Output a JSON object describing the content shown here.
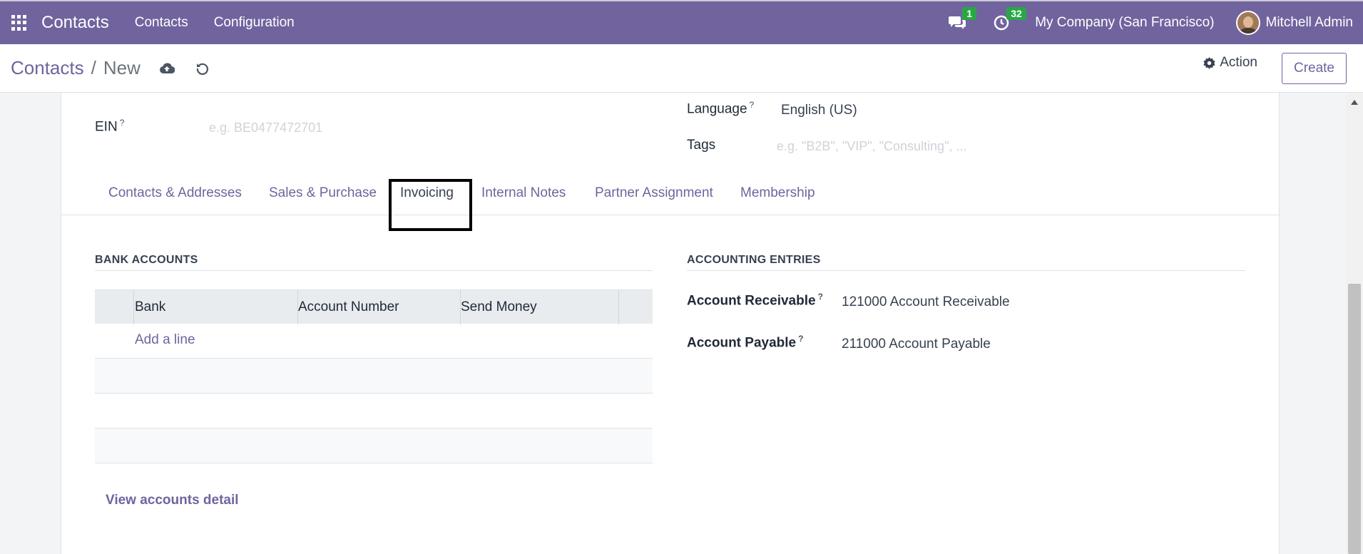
{
  "navbar": {
    "app_name": "Contacts",
    "menu": [
      "Contacts",
      "Configuration"
    ],
    "messages_badge": "1",
    "activities_badge": "32",
    "company": "My Company (San Francisco)",
    "user": "Mitchell Admin",
    "color": "#71639e"
  },
  "control_panel": {
    "breadcrumb_parent": "Contacts",
    "breadcrumb_separator": "/",
    "breadcrumb_current": "New",
    "action_label": "Action",
    "create_label": "Create"
  },
  "form": {
    "ein_label": "EIN",
    "ein_placeholder": "e.g. BE0477472701",
    "language_label": "Language",
    "language_value": "English (US)",
    "tags_label": "Tags",
    "tags_placeholder": "e.g. \"B2B\", \"VIP\", \"Consulting\", ...",
    "help_mark": "?"
  },
  "tabs": [
    {
      "label": "Contacts & Addresses",
      "active": false
    },
    {
      "label": "Sales & Purchase",
      "active": false
    },
    {
      "label": "Invoicing",
      "active": true
    },
    {
      "label": "Internal Notes",
      "active": false
    },
    {
      "label": "Partner Assignment",
      "active": false
    },
    {
      "label": "Membership",
      "active": false
    }
  ],
  "bank_accounts": {
    "title": "BANK ACCOUNTS",
    "columns": [
      "Bank",
      "Account Number",
      "Send Money"
    ],
    "add_line": "Add a line",
    "view_detail": "View accounts detail"
  },
  "accounting": {
    "title": "ACCOUNTING ENTRIES",
    "receivable_label": "Account Receivable",
    "receivable_value": "121000 Account Receivable",
    "payable_label": "Account Payable",
    "payable_value": "211000 Account Payable"
  }
}
